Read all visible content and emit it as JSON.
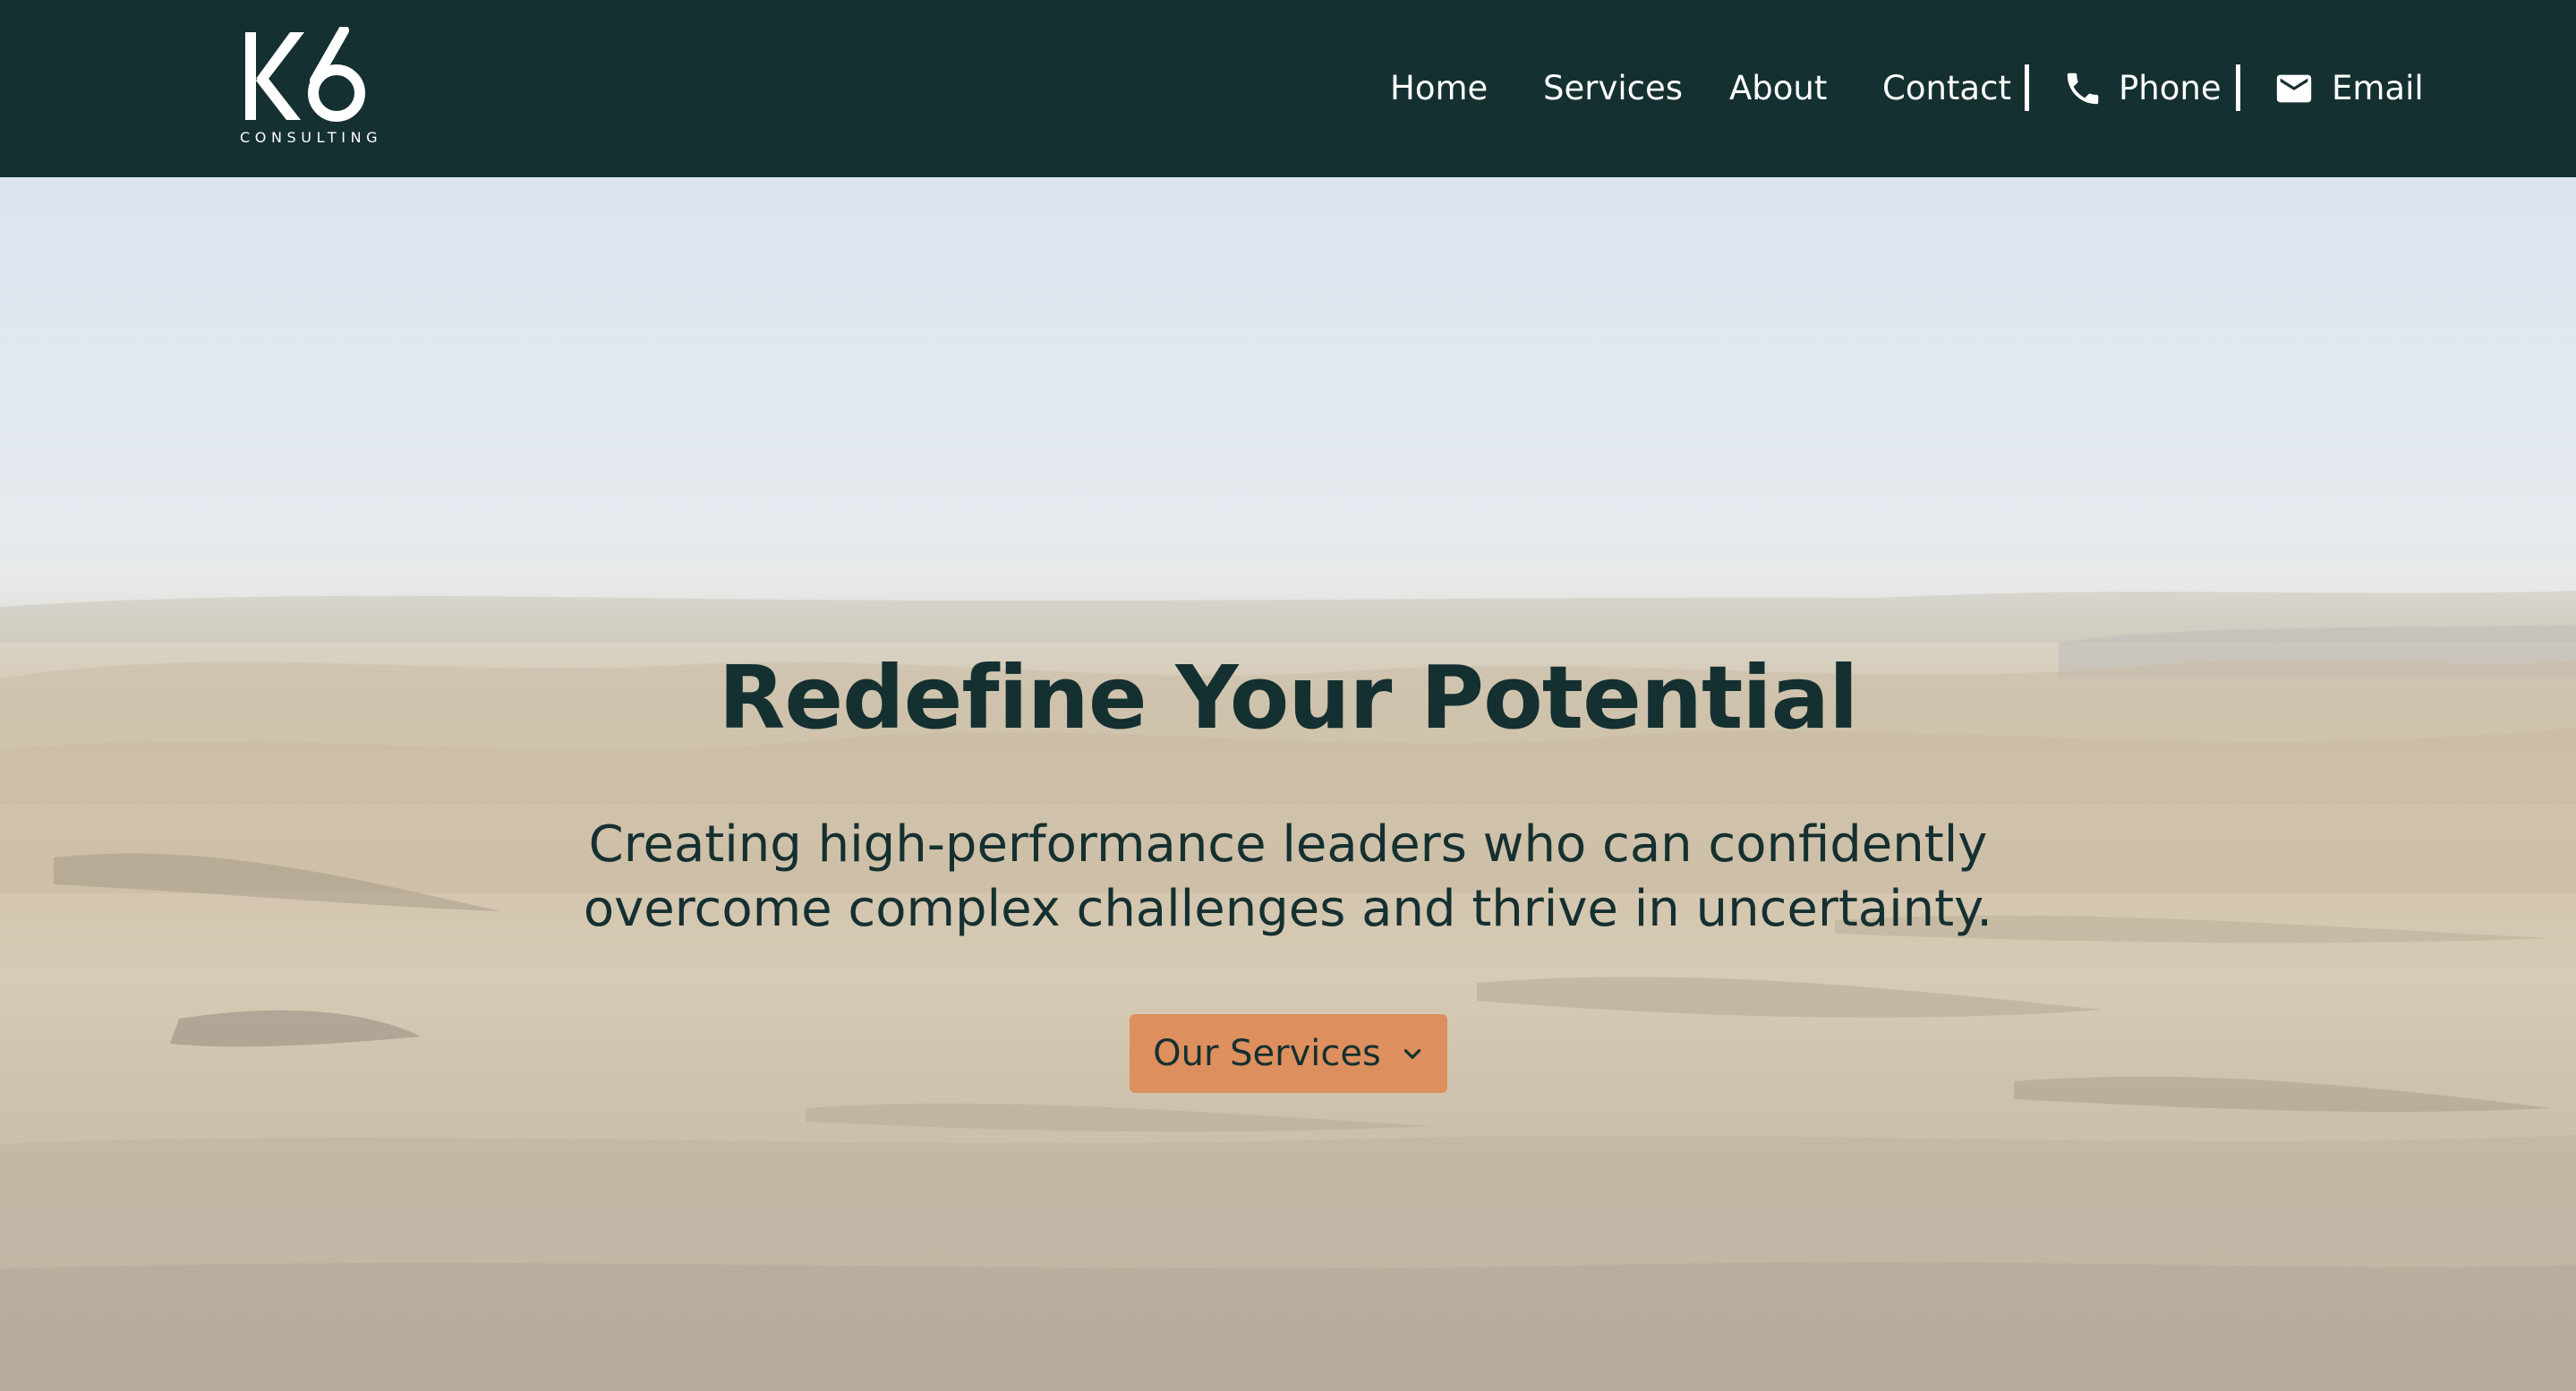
{
  "header": {
    "logo": {
      "mark": "K6",
      "subtitle": "CONSULTING"
    },
    "nav": {
      "home": "Home",
      "services": "Services",
      "about": "About",
      "contact": "Contact",
      "phone": "Phone",
      "email": "Email"
    },
    "icons": {
      "phone": "phone-icon",
      "email": "envelope-icon"
    }
  },
  "hero": {
    "title": "Redefine Your Potential",
    "subtitle_line1": "Creating high-performance leaders who can confidently",
    "subtitle_line2": "overcome complex challenges and thrive in uncertainty.",
    "cta_label": "Our Services",
    "cta_icon": "chevron-down-icon"
  },
  "colors": {
    "header_bg": "#153030",
    "text_dark": "#153030",
    "accent": "#de8f5e",
    "nav_text": "#ffffff"
  }
}
